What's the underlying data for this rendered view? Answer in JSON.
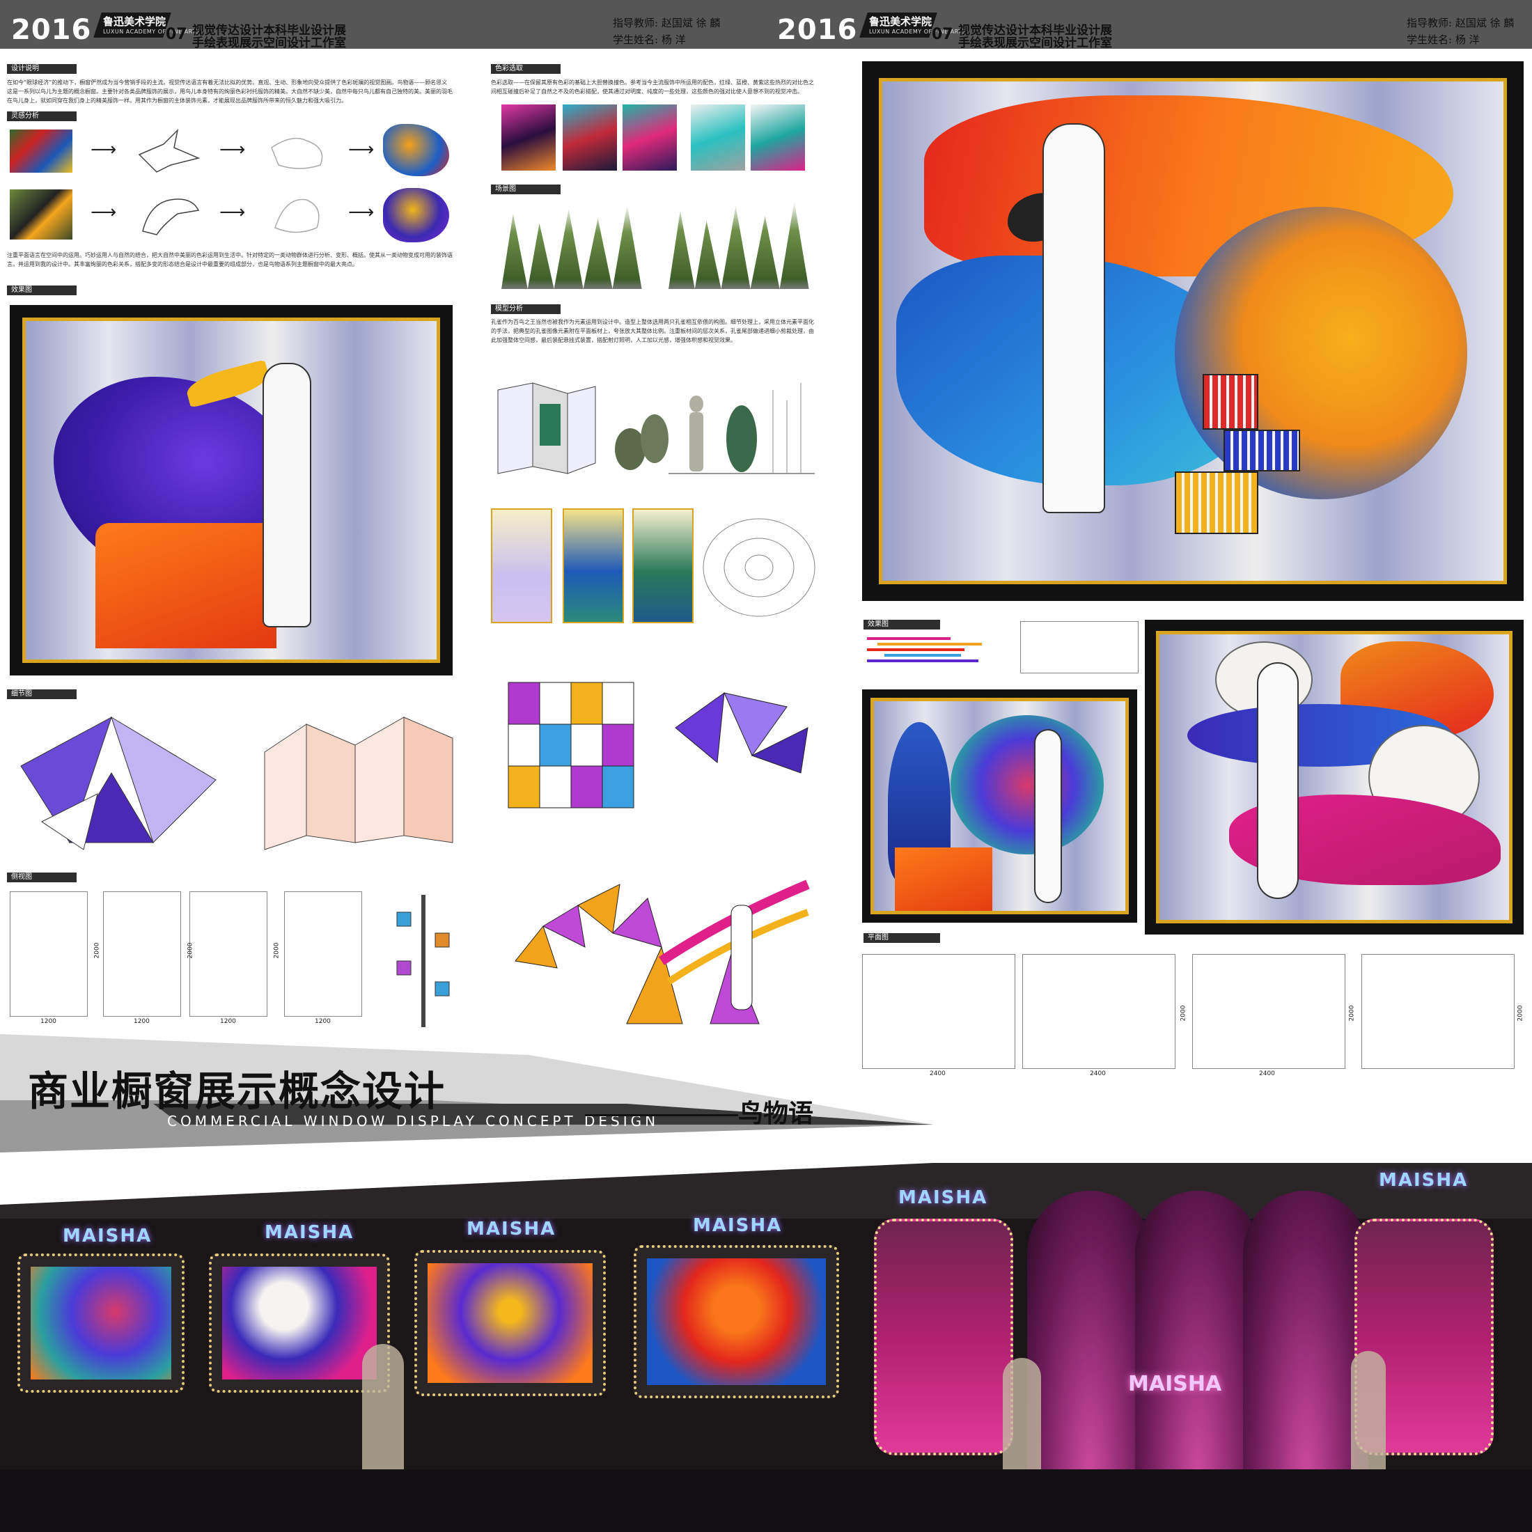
{
  "header": {
    "year": "2016",
    "school_cn": "鲁迅美术学院",
    "school_en": "LUXUN ACADEMY OF FINE ARTS",
    "number": "07",
    "title_line1": "视觉传达设计本科毕业设计展",
    "title_line2": "手绘表现展示空间设计工作室",
    "advisor": "指导教师: 赵国斌   徐 麟",
    "student": "学生姓名: 杨 洋"
  },
  "sections": {
    "design_desc": "设计说明",
    "design_text": "在如今“眼球经济”的推动下，橱窗俨然成为当今营销手段的主流。视觉传达语言有着无法比拟的优势。直观、生动、形象地向受众提供了色彩斑斓的视觉图画。鸟物语——顾名思义这是一系列以鸟儿为主题的概念橱窗。主要针对各类品牌服饰的展示，用鸟儿本身特有的绚丽色彩衬托服饰的精美。大自然不缺少美，自然中每只鸟儿都有自己独特的美。美丽的羽毛在鸟儿身上，就如同穿在我们身上的精美服饰一样。用其作为橱窗的主体装饰元素，才能展现出品牌服饰所带来的恒久魅力和强大吸引力。",
    "inspiration": "灵感分析",
    "inspiration_text": "注重平面语言在空间中的运用。巧妙运用人与自然的结合，把大自然中美丽的色彩运用到生活中。针对特定的一类动物群体进行分析、变形、概括。使其从一类动物变成可用的装饰语言。并运用到我的设计中。其丰富绚丽的色彩关系，搭配多变的形态结合是设计中最重要的组成部分，也是鸟物语系列主题橱窗中的最大亮点。",
    "render": "效果图",
    "detail": "细节图",
    "side_view": "侧视图",
    "color": "色彩选取",
    "color_text": "色彩选取——在保留其原有色彩的基础上大胆替换撞色。参考当今主流服饰中所运用的配色，红绿、蓝橙、黄紫这些热烈的对比色之间相互碰撞后补足了自然之不及的色彩搭配，使其通过对明度、纯度的一些处理，这些颜色的强对比使人意想不到的视觉冲击。",
    "scene": "场景图",
    "model": "模型分析",
    "model_text": "孔雀作为百鸟之王当然也被我作为元素运用到设计中。造型上整体选用两只孔雀相互依偎的构图。细节处理上，采用立体元素平面化的手法，把典型的孔雀图像元素附在平面板材上，夸张放大其整体比例。注重板材间的层次关系，孔雀尾部做递进细小剪裁处理，由此加强整体空间感，最后装配悬挂式装置，搭配射灯照明，人工加以光感，增强体积感和视觉效果。",
    "render2": "效果图",
    "plan": "平面图"
  },
  "dimensions": {
    "side_w": "1200",
    "side_h": "2000",
    "plan_w": "2400",
    "plan_h": "2000"
  },
  "title": {
    "cn": "商业橱窗展示概念设计",
    "en": "COMMERCIAL WINDOW DISPLAY CONCEPT DESIGN",
    "sub": "鸟物语"
  },
  "street": {
    "brand": "MAISHA"
  },
  "colors": {
    "header_bg": "#565656",
    "tag_bg": "#2e2e2e",
    "gold": "#d9a521",
    "purple": "#5a2ad0",
    "orange": "#f05a1a",
    "magenta": "#e0208a"
  }
}
